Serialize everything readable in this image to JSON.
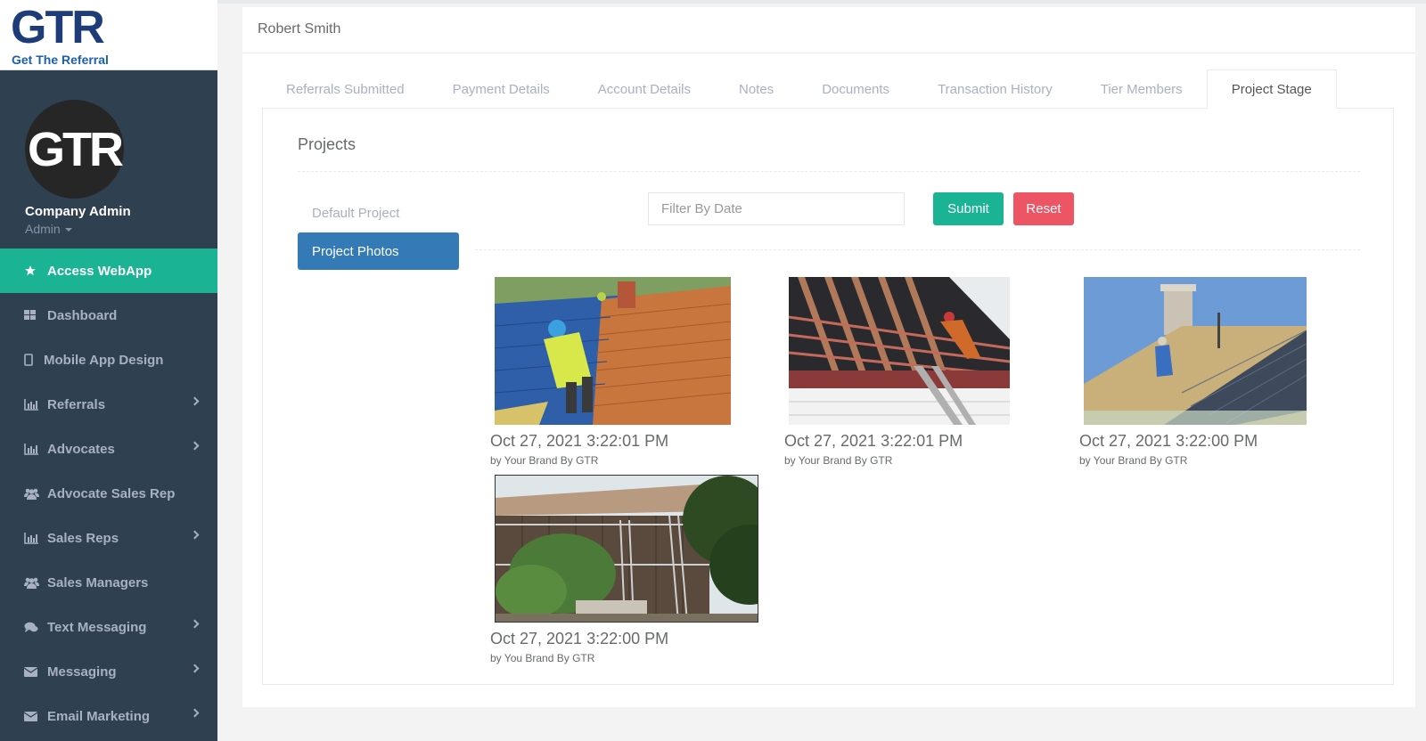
{
  "brand": {
    "logo_text": "GTR",
    "tagline": "Get The Referral"
  },
  "profile": {
    "avatar_text": "GTR",
    "name": "Company Admin",
    "role": "Admin"
  },
  "nav": {
    "items": [
      {
        "label": "Access WebApp",
        "icon": "star-icon",
        "active": true,
        "has_submenu": false
      },
      {
        "label": "Dashboard",
        "icon": "grid-icon",
        "active": false,
        "has_submenu": false
      },
      {
        "label": "Mobile App Design",
        "icon": "mobile-icon",
        "active": false,
        "has_submenu": false
      },
      {
        "label": "Referrals",
        "icon": "bar-chart-icon",
        "active": false,
        "has_submenu": true
      },
      {
        "label": "Advocates",
        "icon": "bar-chart-icon",
        "active": false,
        "has_submenu": true
      },
      {
        "label": "Advocate Sales Rep",
        "icon": "users-icon",
        "active": false,
        "has_submenu": false
      },
      {
        "label": "Sales Reps",
        "icon": "bar-chart-icon",
        "active": false,
        "has_submenu": true
      },
      {
        "label": "Sales Managers",
        "icon": "users-icon",
        "active": false,
        "has_submenu": false
      },
      {
        "label": "Text Messaging",
        "icon": "chat-icon",
        "active": false,
        "has_submenu": true
      },
      {
        "label": "Messaging",
        "icon": "envelope-icon",
        "active": false,
        "has_submenu": true
      },
      {
        "label": "Email Marketing",
        "icon": "envelope-icon",
        "active": false,
        "has_submenu": true
      }
    ]
  },
  "header": {
    "user_name": "Robert Smith"
  },
  "tabs": [
    {
      "label": "Referrals Submitted",
      "active": false
    },
    {
      "label": "Payment Details",
      "active": false
    },
    {
      "label": "Account Details",
      "active": false
    },
    {
      "label": "Notes",
      "active": false
    },
    {
      "label": "Documents",
      "active": false
    },
    {
      "label": "Transaction History",
      "active": false
    },
    {
      "label": "Tier Members",
      "active": false
    },
    {
      "label": "Project Stage",
      "active": true
    }
  ],
  "projects": {
    "title": "Projects",
    "side_tabs": [
      {
        "label": "Default Project",
        "active": false
      },
      {
        "label": "Project Photos",
        "active": true
      }
    ],
    "filter": {
      "placeholder": "Filter By Date",
      "value": ""
    },
    "submit_label": "Submit",
    "reset_label": "Reset",
    "photos": [
      {
        "date": "Oct 27, 2021 3:22:01 PM",
        "by": "by Your Brand By GTR",
        "scene": "roofer-tiles"
      },
      {
        "date": "Oct 27, 2021 3:22:01 PM",
        "by": "by Your Brand By GTR",
        "scene": "roof-rafters"
      },
      {
        "date": "Oct 27, 2021 3:22:00 PM",
        "by": "by Your Brand By GTR",
        "scene": "metal-roof"
      },
      {
        "date": "Oct 27, 2021 3:22:00 PM",
        "by": "by You Brand By GTR",
        "scene": "house-scaffold"
      }
    ]
  },
  "colors": {
    "sidebar_bg": "#2f4050",
    "active_nav": "#1ab394",
    "primary_blue": "#337ab7",
    "submit_green": "#1ab394",
    "reset_red": "#ed5565",
    "brand_navy": "#1d3c78"
  }
}
